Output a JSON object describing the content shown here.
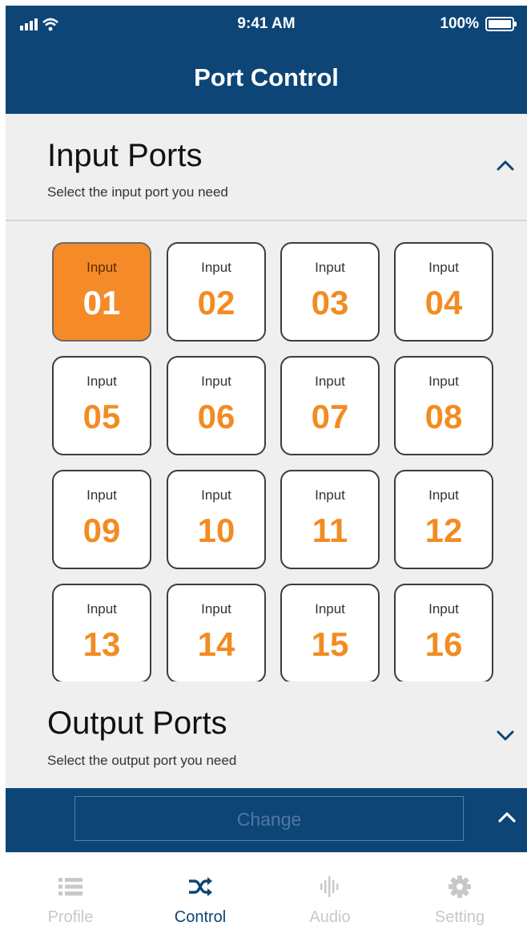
{
  "status_bar": {
    "time": "9:41 AM",
    "battery": "100%"
  },
  "header": {
    "title": "Port Control"
  },
  "input_section": {
    "title": "Input Ports",
    "subtitle": "Select the input port you need",
    "expanded": true
  },
  "ports": [
    {
      "label": "Input",
      "number": "01",
      "selected": true
    },
    {
      "label": "Input",
      "number": "02",
      "selected": false
    },
    {
      "label": "Input",
      "number": "03",
      "selected": false
    },
    {
      "label": "Input",
      "number": "04",
      "selected": false
    },
    {
      "label": "Input",
      "number": "05",
      "selected": false
    },
    {
      "label": "Input",
      "number": "06",
      "selected": false
    },
    {
      "label": "Input",
      "number": "07",
      "selected": false
    },
    {
      "label": "Input",
      "number": "08",
      "selected": false
    },
    {
      "label": "Input",
      "number": "09",
      "selected": false
    },
    {
      "label": "Input",
      "number": "10",
      "selected": false
    },
    {
      "label": "Input",
      "number": "11",
      "selected": false
    },
    {
      "label": "Input",
      "number": "12",
      "selected": false
    },
    {
      "label": "Input",
      "number": "13",
      "selected": false
    },
    {
      "label": "Input",
      "number": "14",
      "selected": false
    },
    {
      "label": "Input",
      "number": "15",
      "selected": false
    },
    {
      "label": "Input",
      "number": "16",
      "selected": false
    }
  ],
  "output_section": {
    "title": "Output Ports",
    "subtitle": "Select the output port you need",
    "expanded": false
  },
  "action_bar": {
    "change_label": "Change"
  },
  "tabs": [
    {
      "label": "Profile",
      "icon": "list-icon",
      "active": false
    },
    {
      "label": "Control",
      "icon": "shuffle-icon",
      "active": true
    },
    {
      "label": "Audio",
      "icon": "audio-wave-icon",
      "active": false
    },
    {
      "label": "Setting",
      "icon": "gear-icon",
      "active": false
    }
  ],
  "colors": {
    "brand_blue": "#0d4576",
    "accent_orange": "#f28c22",
    "background": "#efefef"
  }
}
